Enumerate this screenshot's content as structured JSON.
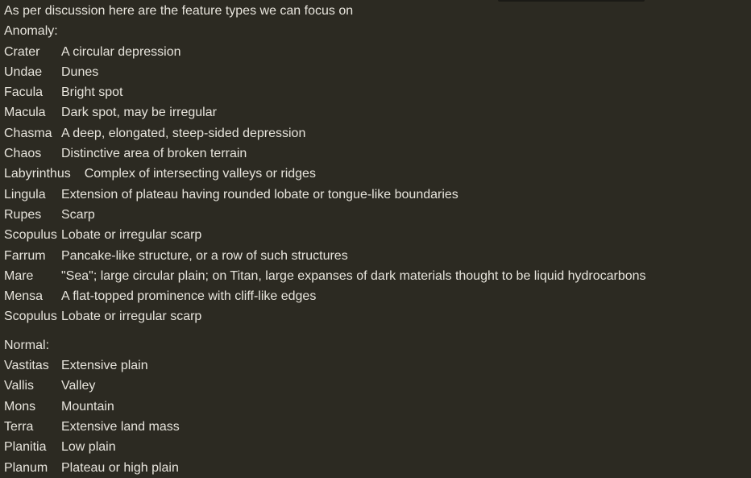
{
  "intro": "As per discussion here are the feature types we can focus on",
  "sections": [
    {
      "title": "Anomaly:",
      "items": [
        {
          "term": "Crater",
          "desc": "A circular depression"
        },
        {
          "term": "Undae",
          "desc": "Dunes"
        },
        {
          "term": "Facula",
          "desc": "Bright spot"
        },
        {
          "term": "Macula",
          "desc": "Dark spot, may be irregular"
        },
        {
          "term": "Chasma",
          "desc": "A deep, elongated, steep-sided depression"
        },
        {
          "term": "Chaos",
          "desc": "Distinctive area of broken terrain"
        },
        {
          "term": "Labyrinthus",
          "desc": "Complex of intersecting valleys or ridges"
        },
        {
          "term": "Lingula",
          "desc": "Extension of plateau having rounded lobate or tongue-like boundaries"
        },
        {
          "term": "Rupes",
          "desc": "Scarp"
        },
        {
          "term": "Scopulus",
          "desc": "Lobate or irregular scarp"
        },
        {
          "term": "Farrum",
          "desc": "Pancake-like structure, or a row of such structures"
        },
        {
          "term": "Mare",
          "desc": "\"Sea\"; large circular plain; on Titan, large expanses of dark materials thought to be liquid hydrocarbons"
        },
        {
          "term": "Mensa",
          "desc": "A flat-topped prominence with cliff-like edges"
        },
        {
          "term": "Scopulus",
          "desc": "Lobate or irregular scarp"
        }
      ]
    },
    {
      "title": "Normal:",
      "items": [
        {
          "term": "Vastitas",
          "desc": "Extensive plain"
        },
        {
          "term": "Vallis",
          "desc": "Valley"
        },
        {
          "term": "Mons",
          "desc": "Mountain"
        },
        {
          "term": "Terra",
          "desc": "Extensive land mass"
        },
        {
          "term": "Planitia",
          "desc": "Low plain"
        },
        {
          "term": "Planum",
          "desc": "Plateau or high plain"
        }
      ]
    }
  ]
}
